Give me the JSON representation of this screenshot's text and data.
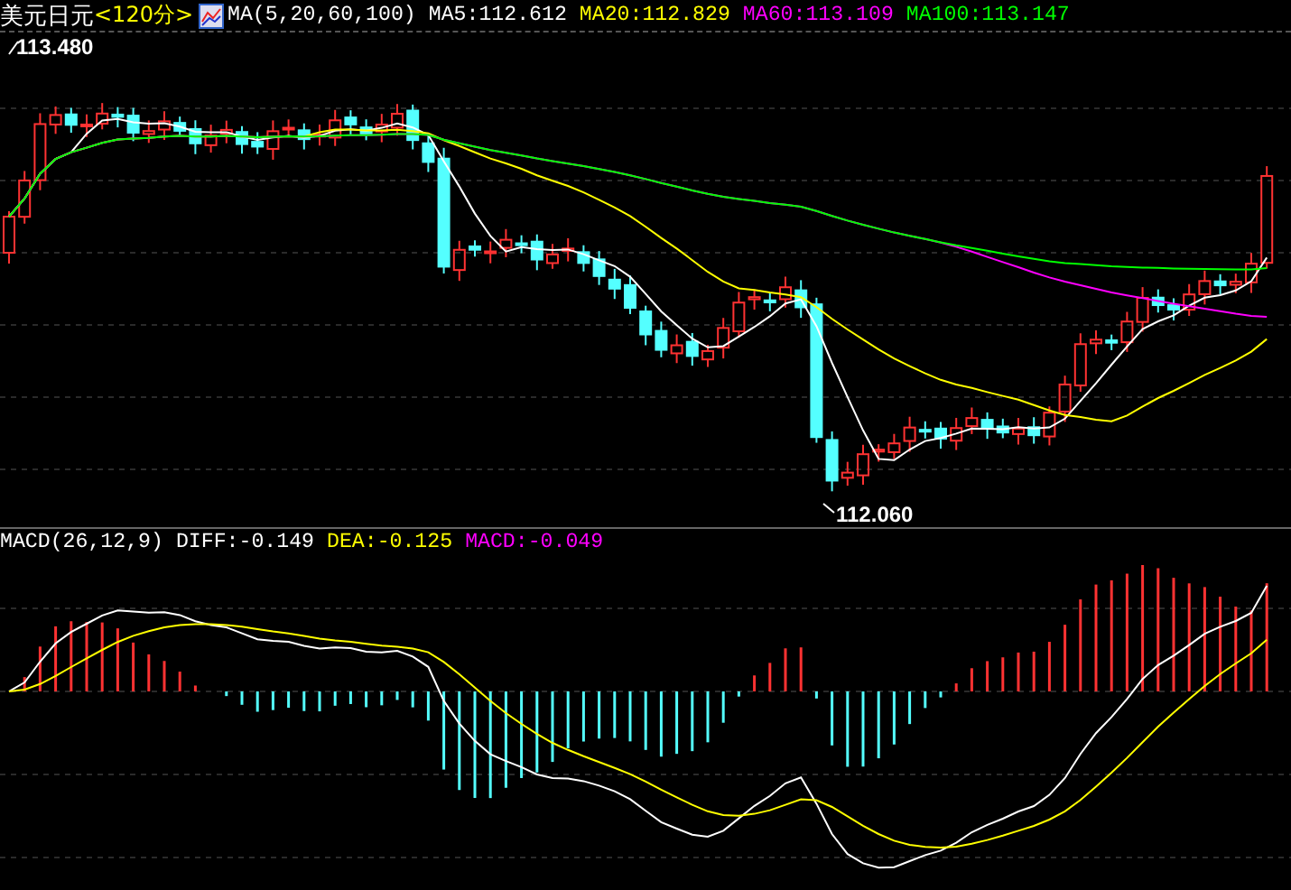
{
  "header": {
    "symbol": "美元日元",
    "period": "<120分>",
    "indicator": "MA(5,20,60,100)",
    "ma_values": [
      {
        "label": "MA5:112.612",
        "color": "#ffffff"
      },
      {
        "label": "MA20:112.829",
        "color": "#ffff00"
      },
      {
        "label": "MA60:113.109",
        "color": "#ff00ff"
      },
      {
        "label": "MA100:113.147",
        "color": "#00ff00"
      }
    ]
  },
  "price_chart": {
    "high_label": "113.480",
    "low_label": "112.060"
  },
  "macd": {
    "indicator": "MACD(26,12,9)",
    "values": [
      {
        "label": "DIFF:-0.149",
        "color": "#ffffff"
      },
      {
        "label": "DEA:-0.125",
        "color": "#ffff00"
      },
      {
        "label": "MACD:-0.049",
        "color": "#ff00ff"
      }
    ]
  }
}
